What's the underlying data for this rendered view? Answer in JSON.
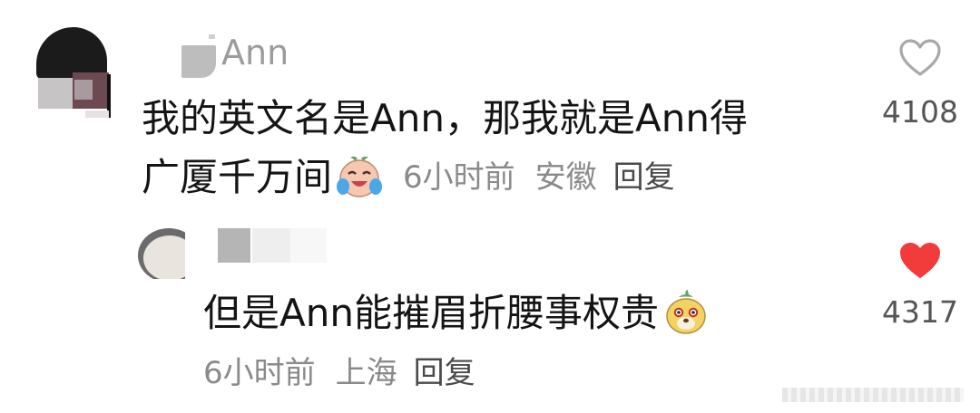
{
  "comments": [
    {
      "username": "Ann",
      "text_line1": "我的英文名是Ann，那我就是Ann得",
      "text_line2": "广厦千万间",
      "emoji": "laughing-crying-face-emoji",
      "time": "6小时前",
      "location": "安徽",
      "reply_label": "回复",
      "like_count": "4108",
      "liked": false,
      "like_color": "#b8b8b8"
    },
    {
      "username": "",
      "text": "但是Ann能摧眉折腰事权贵",
      "emoji": "dog-face-emoji",
      "time": "6小时前",
      "location": "上海",
      "reply_label": "回复",
      "like_count": "4317",
      "liked": true,
      "like_color": "#f23b3b"
    }
  ]
}
